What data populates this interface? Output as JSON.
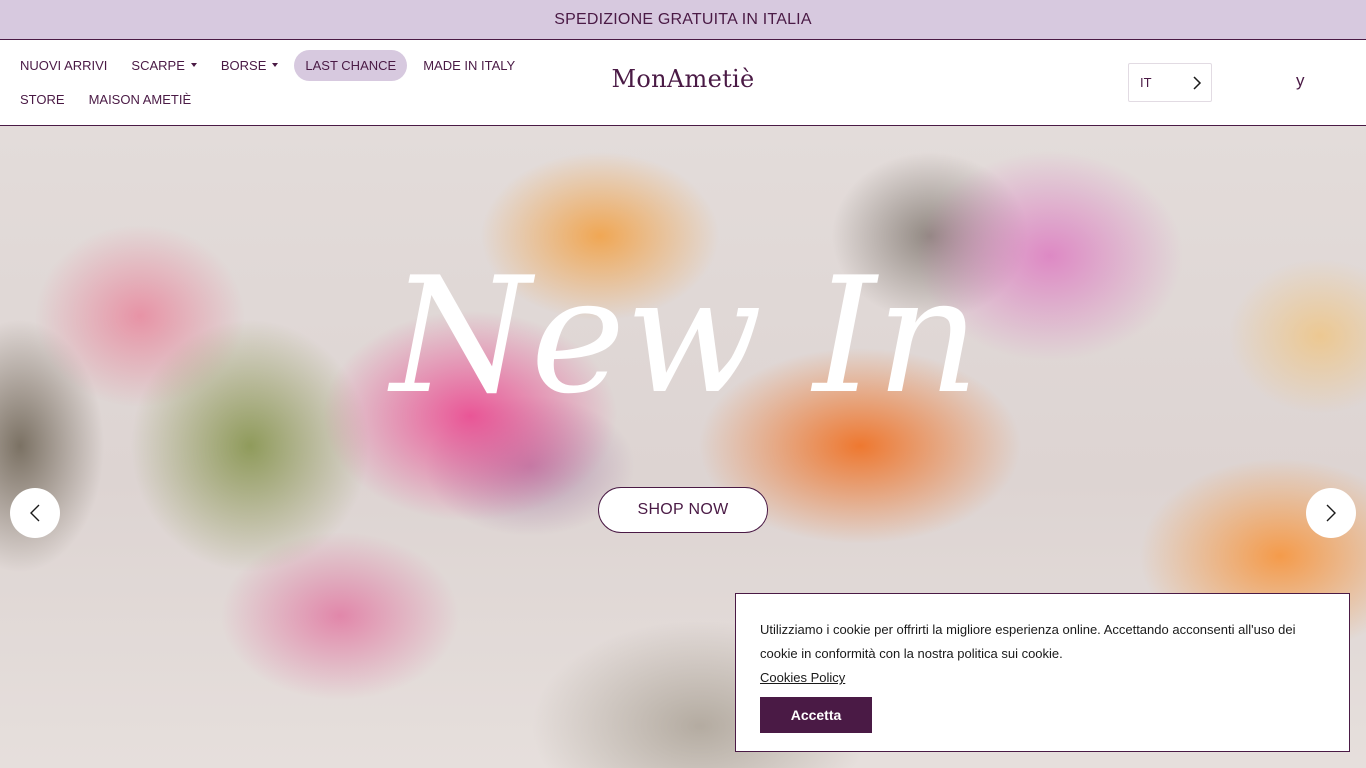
{
  "promo": {
    "text": "SPEDIZIONE GRATUITA IN ITALIA"
  },
  "nav": {
    "row1": [
      {
        "label": "NUOVI ARRIVI"
      },
      {
        "label": "SCARPE"
      },
      {
        "label": "BORSE"
      },
      {
        "label": "LAST CHANCE"
      },
      {
        "label": "MADE IN ITALY"
      }
    ],
    "row2": [
      {
        "label": "STORE"
      },
      {
        "label": "MAISON AMETIÈ"
      }
    ]
  },
  "logo": {
    "text": "MonAmetiè"
  },
  "language": {
    "value": "IT"
  },
  "cart": {
    "icon": "cart-icon",
    "glyph": "y"
  },
  "hero": {
    "title": "New In",
    "cta_label": "SHOP NOW",
    "prev_icon": "chevron-left-icon",
    "next_icon": "chevron-right-icon"
  },
  "cookie": {
    "message": "Utilizziamo i cookie per offrirti la migliore esperienza online. Accettando acconsenti all'uso dei cookie in conformità con la nostra politica sui cookie.",
    "link_label": "Cookies Policy",
    "accept_label": "Accetta"
  },
  "colors": {
    "brand": "#4a1a45",
    "promo_bg": "#d7c9df",
    "pill_bg": "#d7c9df"
  }
}
